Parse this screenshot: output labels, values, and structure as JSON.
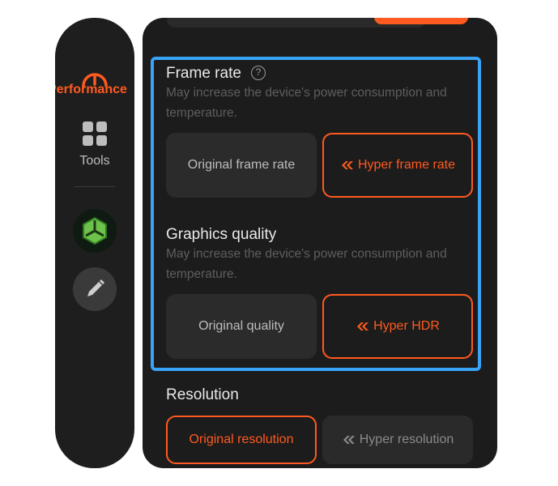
{
  "colors": {
    "accent": "#ff5a1f",
    "highlight": "#39a3f5",
    "panel": "#1c1c1c",
    "tile": "#2b2b2b"
  },
  "sidebar": {
    "items": [
      {
        "label": "Performance",
        "icon": "gauge-icon",
        "selected": true
      },
      {
        "label": "Tools",
        "icon": "grid-icon",
        "selected": false
      }
    ],
    "extra_icons": [
      "game-logo-icon",
      "edit-pencil-icon"
    ]
  },
  "sections": {
    "frame_rate": {
      "title": "Frame rate",
      "help_glyph": "?",
      "description": "May increase the device's power consumption and temperature.",
      "options": [
        {
          "label": "Original frame rate",
          "selected": false
        },
        {
          "label": "Hyper frame rate",
          "selected": true,
          "icon": "hyper-boost-icon"
        }
      ]
    },
    "graphics_quality": {
      "title": "Graphics quality",
      "description": "May increase the device's power consumption and temperature.",
      "options": [
        {
          "label": "Original quality",
          "selected": false
        },
        {
          "label": "Hyper HDR",
          "selected": true,
          "icon": "hyper-boost-icon"
        }
      ]
    },
    "resolution": {
      "title": "Resolution",
      "options": [
        {
          "label": "Original resolution",
          "selected": true
        },
        {
          "label": "Hyper resolution",
          "selected": false,
          "icon": "hyper-boost-icon"
        }
      ]
    }
  }
}
